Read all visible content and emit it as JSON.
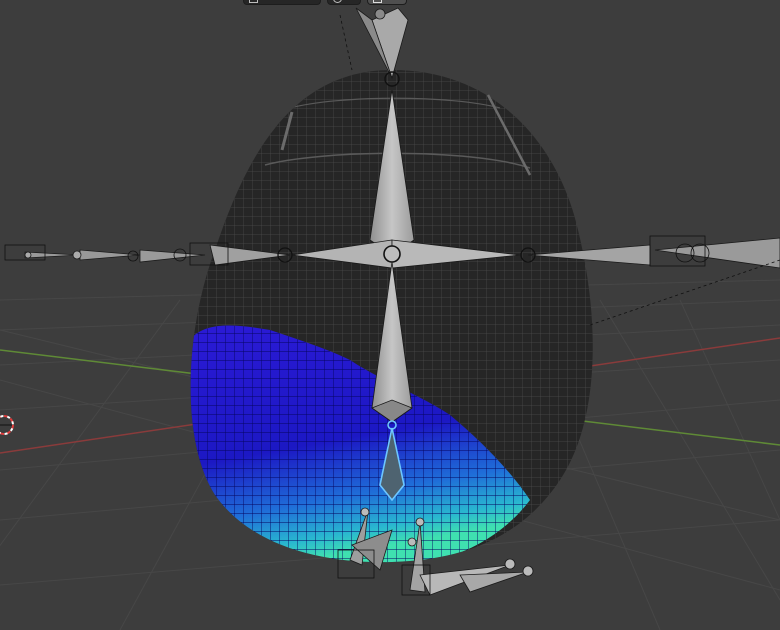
{
  "app": "3D Viewport",
  "viewport": {
    "background": "#3d3d3d",
    "grid_color": "#474747",
    "axis_x_color": "#8a3b3b",
    "axis_y_color": "#5f8a36"
  },
  "header_gizmos": [
    {
      "icon": "transform-orientation-icon"
    },
    {
      "icon": "pivot-point-icon"
    },
    {
      "icon": "snap-icon"
    }
  ],
  "scene": {
    "mesh": {
      "type": "egg",
      "color": "#262626",
      "wire_color": "#4a4a4a"
    },
    "weight_paint": {
      "low": "#1a10c8",
      "high": "#2ed3c3"
    },
    "armature": {
      "bone_color": "#b0b0b0",
      "selected_bone_color": "#6ec6ff"
    },
    "cursor": {
      "icon": "3d-cursor-icon",
      "colors": [
        "#e03c3c",
        "#ffffff"
      ]
    }
  }
}
